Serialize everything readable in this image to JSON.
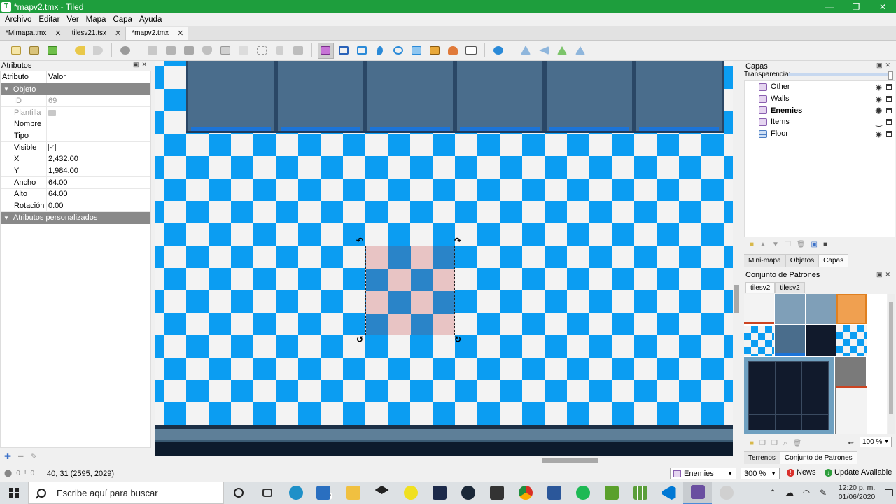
{
  "window": {
    "title": "*mapv2.tmx - Tiled",
    "minimize": "—",
    "restore": "❐",
    "close": "✕",
    "app_icon": "tiled-icon"
  },
  "menu": {
    "items": [
      "Archivo",
      "Editar",
      "Ver",
      "Mapa",
      "Capa",
      "Ayuda"
    ]
  },
  "tabs": [
    {
      "label": "*Mimapa.tmx",
      "close": "✕"
    },
    {
      "label": "tilesv21.tsx",
      "close": "✕"
    },
    {
      "label": "*mapv2.tmx",
      "close": "✕",
      "active": true
    }
  ],
  "properties": {
    "panel_title": "Atributos",
    "col_attr": "Atributo",
    "col_value": "Valor",
    "group_object": "Objeto",
    "group_custom": "Atributos personalizados",
    "rows": [
      {
        "key": "ID",
        "value": "69",
        "dim": true
      },
      {
        "key": "Plantilla",
        "value": "",
        "dim": true
      },
      {
        "key": "Nombre",
        "value": ""
      },
      {
        "key": "Tipo",
        "value": ""
      },
      {
        "key": "Visible",
        "value": "✓"
      },
      {
        "key": "X",
        "value": "2,432.00"
      },
      {
        "key": "Y",
        "value": "1,984.00"
      },
      {
        "key": "Ancho",
        "value": "64.00"
      },
      {
        "key": "Alto",
        "value": "64.00"
      },
      {
        "key": "Rotación",
        "value": "0.00"
      }
    ]
  },
  "layers": {
    "panel_title": "Capas",
    "opacity_label": "Transparencia:",
    "items": [
      {
        "name": "Other",
        "type": "object"
      },
      {
        "name": "Walls",
        "type": "object"
      },
      {
        "name": "Enemies",
        "type": "object",
        "selected": true
      },
      {
        "name": "Items",
        "type": "object",
        "hidden": true
      },
      {
        "name": "Floor",
        "type": "tile"
      }
    ],
    "tabs": [
      "Mini-mapa",
      "Objetos",
      "Capas"
    ]
  },
  "tilesets": {
    "panel_title": "Conjunto de Patrones",
    "tabs": [
      "tilesv2",
      "tilesv2"
    ],
    "zoom": "100 %",
    "bottom_tabs": [
      "Terrenos",
      "Conjunto de Patrones"
    ]
  },
  "status": {
    "counts": "0",
    "counts2": "0",
    "coords": "40, 31 (2595, 2029)",
    "current_layer": "Enemies",
    "zoom": "300 %",
    "news": "News",
    "update": "Update Available"
  },
  "taskbar": {
    "search_placeholder": "Escribe aquí para buscar",
    "badge": "2",
    "time": "12:20 p. m.",
    "date": "01/06/2020"
  },
  "colors": {
    "titlebar": "#1e9e3d",
    "floor_blue": "#0b9df2",
    "floor_white": "#f3f3f3",
    "wall": "#4a6d8c",
    "selected_tile_pink": "#e8c4c4"
  }
}
